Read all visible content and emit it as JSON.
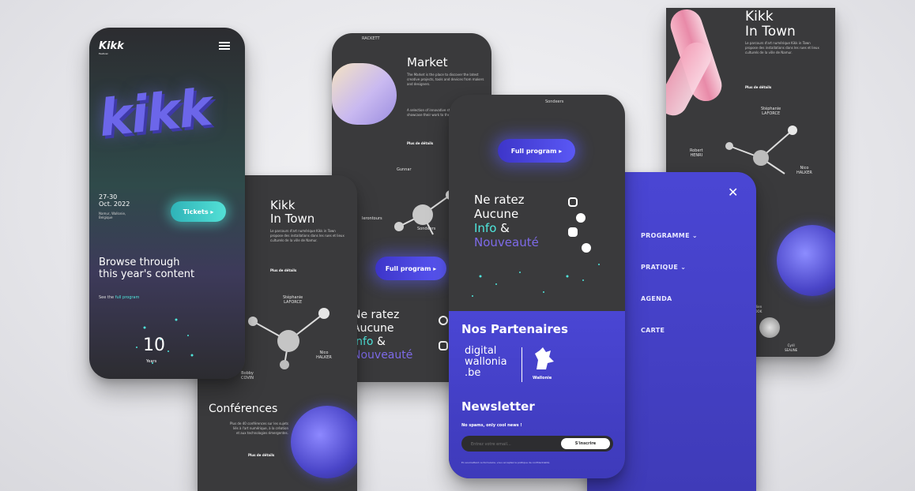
{
  "phone1": {
    "logo": "Kikk",
    "logo_sub": "Festival",
    "hero_word": "kikk",
    "dates": "27-30\nOct. 2022",
    "location": "Namur, Wallonie,\nBelgique",
    "tickets_label": "Tickets ▸",
    "browse_heading": "Browse through\nthis year's content",
    "see_prefix": "See the ",
    "see_link": "full program",
    "years_number": "10",
    "years_label": "Years"
  },
  "phone2": {
    "heading": "Kikk\nIn Town",
    "body": "Le parcours d'art numérique Kikk in Town propose des installations dans les rues et lieux culturels de la ville de Namur.",
    "more": "Plus de détails",
    "node_top": "Stéphanie\nLAFORCE",
    "node_left": "Bobby\nCOVIN",
    "node_right": "Nico\nHALKER",
    "section_title": "Conférences",
    "section_body": "Plus de 40 conférences sur les sujets liés à l'art numérique, à la création et aux technologies émergentes.",
    "section_more": "Plus de détails"
  },
  "phone3": {
    "top_label": "RACKETT",
    "heading": "Market",
    "body1": "The Market is the place to discover the latest creative projects, tools and devices from makers and designers.",
    "body2": "A selection of innovative startups and creators showcase their work to the public.",
    "more": "Plus de détails",
    "node1": "Gunnar",
    "node2": "Ierontours",
    "node3": "Sondeers",
    "program_label": "Full program ▸",
    "ne_ratez_1": "Ne ratez",
    "ne_ratez_2": "Aucune",
    "info": "Info",
    "amp": " &",
    "nouveaute": "Nouveauté"
  },
  "phone4": {
    "top_label": "Sondeers",
    "program_label": "Full program ▸",
    "ne_ratez_1": "Ne ratez",
    "ne_ratez_2": "Aucune",
    "info": "Info",
    "amp": " &",
    "nouveaute": "Nouveauté",
    "partners_title": "Nos Partenaires",
    "partner1": "digital\nwallonia\n.be",
    "partner2": "Wallonie",
    "newsletter_title": "Newsletter",
    "newsletter_sub": "No spams, only cool news !",
    "email_placeholder": "Entrez votre email...",
    "subscribe_label": "S'inscrire",
    "footer_text": "En soumettant ce formulaire, vous acceptez la politique de confidentialité."
  },
  "phone5": {
    "close": "✕",
    "menu": [
      "PROGRAMME ⌄",
      "PRATIQUE ⌄",
      "AGENDA",
      "CARTE"
    ]
  },
  "phone6": {
    "heading": "Kikk\nIn Town",
    "body": "Le parcours d'art numérique Kikk in Town propose des installations dans les rues et lieux culturels de la ville de Namur.",
    "more": "Plus de détails",
    "node_top": "Stéphanie\nLAFORCE",
    "node_left": "Robert\nHENRI",
    "node_right": "Nico\nHALKER",
    "node_bottom_left": "Julien\nPOOK",
    "node_bottom_right": "Cyril\nSEAUNE"
  },
  "colors": {
    "background": "#e6e6ea",
    "dark_panel": "#3a3a3c",
    "accent_blue": "#4c45d9",
    "accent_teal": "#4fe6dc",
    "accent_purple": "#7d6ae8"
  }
}
